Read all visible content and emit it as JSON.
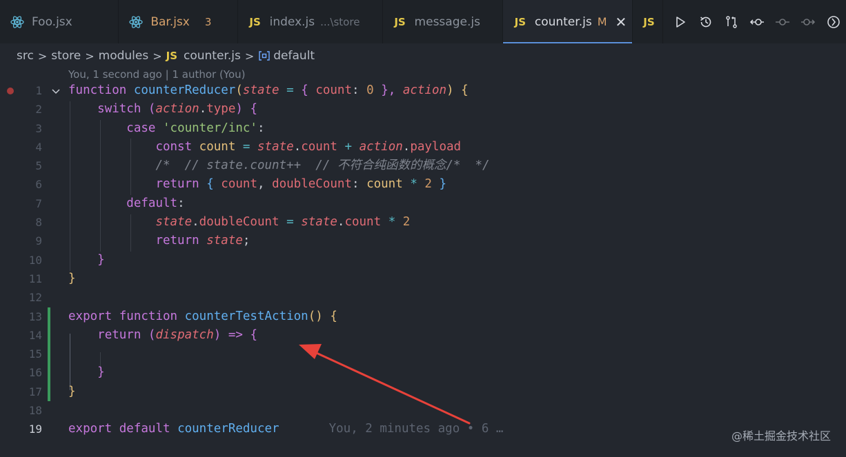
{
  "tabs": [
    {
      "name": "Foo.jsx",
      "icon": "react-icon",
      "active": false
    },
    {
      "name": "Bar.jsx",
      "icon": "react-icon",
      "badge": "3",
      "active": false
    },
    {
      "name": "index.js",
      "icon": "js-icon",
      "hint": "...\\store",
      "active": false
    },
    {
      "name": "message.js",
      "icon": "js-icon",
      "active": false
    },
    {
      "name": "counter.js",
      "icon": "js-icon",
      "modified": "M",
      "active": true
    },
    {
      "name": "",
      "icon": "js-icon",
      "active": false
    }
  ],
  "js_icon_text": "JS",
  "breadcrumb": [
    "src",
    "store",
    "modules",
    "counter.js",
    "default"
  ],
  "blame_header": "You, 1 second ago | 1 author (You)",
  "line_numbers": [
    "1",
    "2",
    "3",
    "4",
    "5",
    "6",
    "7",
    "8",
    "9",
    "10",
    "11",
    "12",
    "13",
    "14",
    "15",
    "16",
    "17",
    "18",
    "19"
  ],
  "code": {
    "l1": [
      "function",
      "counterReducer",
      "(",
      "state",
      "=",
      "{",
      "count",
      "0",
      "},",
      "action",
      ")",
      "{"
    ],
    "l2": [
      "switch",
      "(",
      "action",
      ".",
      "type",
      ")",
      "{"
    ],
    "l3": [
      "case",
      "'counter/inc'",
      ":"
    ],
    "l4": [
      "const",
      "count",
      "=",
      "state",
      ".",
      "count",
      "+",
      "action",
      ".",
      "payload"
    ],
    "l5": "/*  // state.count++  // 不符合纯函数的概念/*  */",
    "l6": [
      "return",
      "{",
      "count",
      ",",
      "doubleCount",
      ":",
      "count",
      "*",
      "2",
      "}"
    ],
    "l7": [
      "default",
      ":"
    ],
    "l8": [
      "state",
      ".",
      "doubleCount",
      "=",
      "state",
      ".",
      "count",
      "*",
      "2"
    ],
    "l9": [
      "return",
      "state",
      ";"
    ],
    "l10": "}",
    "l11": "}",
    "l13": [
      "export",
      "function",
      "counterTestAction",
      "()",
      "{"
    ],
    "l14": [
      "return",
      "(",
      "dispatch",
      ")",
      "=>",
      "{"
    ],
    "l16": "}",
    "l17": "}",
    "l19": [
      "export",
      "default",
      "counterReducer"
    ]
  },
  "blame_inline": "You, 2 minutes ago • 6 …",
  "watermark": "@稀土掘金技术社区",
  "colors": {
    "background": "#23272e",
    "keyword": "#c678dd",
    "function": "#61afef",
    "parameter": "#e06c75",
    "number": "#d19a66",
    "string": "#98c379",
    "arrow": "#e8423a"
  }
}
